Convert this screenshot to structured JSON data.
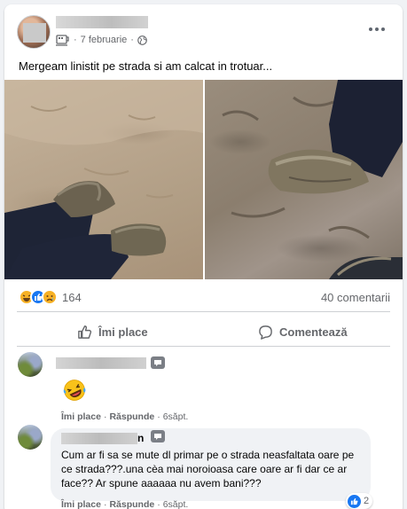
{
  "post": {
    "date": "7 februarie",
    "text": "Mergeam linistit pe strada si am calcat in trotuar...",
    "audience_icon": "globe-icon",
    "status_icon": "coffee-cup-icon"
  },
  "stats": {
    "reactions": [
      "laugh",
      "like",
      "sad"
    ],
    "reaction_count": "164",
    "comments_count": "40 comentarii"
  },
  "actions": {
    "like_label": "Îmi place",
    "comment_label": "Comentează"
  },
  "comments": [
    {
      "content_emoji": "rolling-on-floor-laughing",
      "like_label": "Îmi place",
      "reply_label": "Răspunde",
      "time": "6săpt."
    },
    {
      "name_suffix": "n",
      "text": "Cum ar fi sa se mute dl primar pe o strada neasfaltata oare pe ce strada???.una cèa mai noroioasa care oare ar fi dar ce ar face?? Ar spune aaaaaa nu avem bani???",
      "like_count": "2",
      "like_label": "Îmi place",
      "reply_label": "Răspunde",
      "time": "6săpt."
    }
  ],
  "colors": {
    "like_blue": "#1877f2",
    "muted_text": "#65676b",
    "background": "#f0f2f5"
  }
}
